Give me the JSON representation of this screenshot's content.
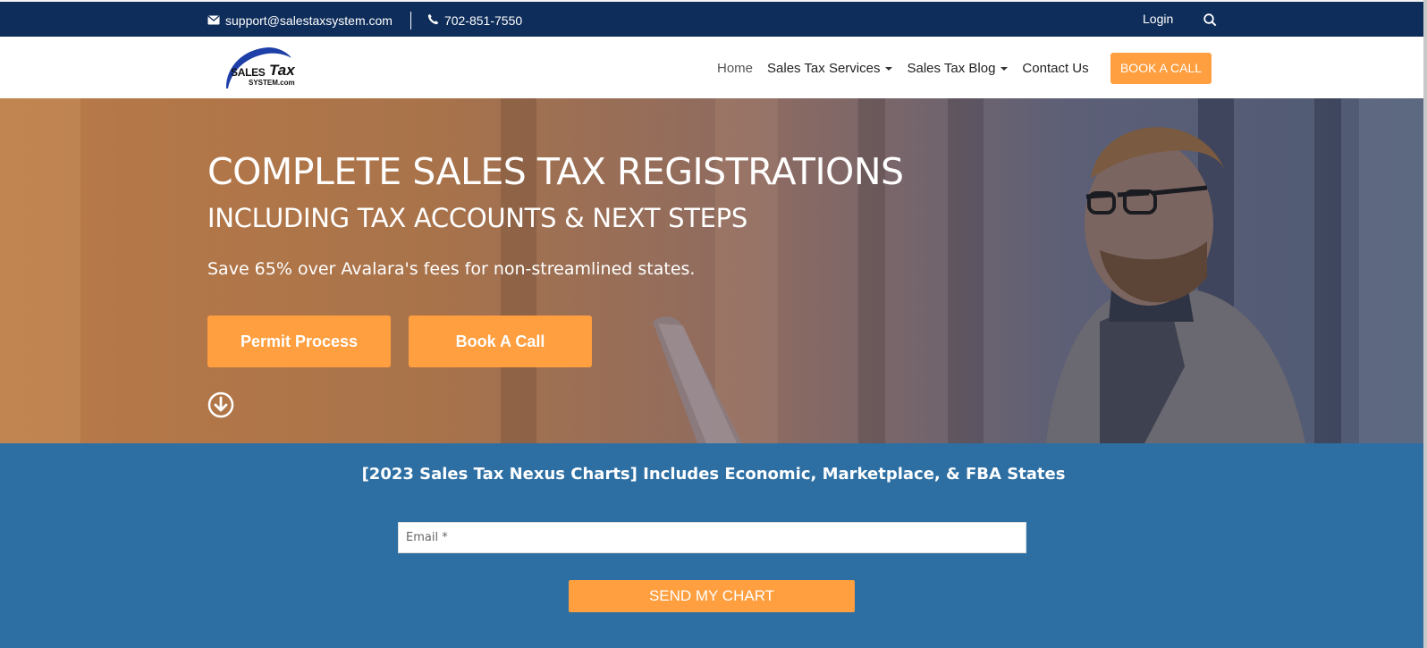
{
  "topbar": {
    "email": "support@salestaxsystem.com",
    "phone": "702-851-7550",
    "login": "Login"
  },
  "logo": {
    "word1": "SALES",
    "word2": "Tax",
    "word3": "SYSTEM.com"
  },
  "nav": {
    "items": [
      {
        "label": "Home"
      },
      {
        "label": "Sales Tax Services"
      },
      {
        "label": "Sales Tax Blog"
      },
      {
        "label": "Contact Us"
      }
    ],
    "cta": "BOOK A CALL"
  },
  "hero": {
    "title": "COMPLETE SALES TAX REGISTRATIONS",
    "subtitle": "INCLUDING TAX ACCOUNTS & NEXT STEPS",
    "tagline": "Save 65% over Avalara's fees for non-streamlined states.",
    "primary_button": "Permit Process",
    "secondary_button": "Book A Call"
  },
  "lead": {
    "heading": "[2023 Sales Tax Nexus Charts] Includes Economic, Marketplace, & FBA States",
    "email_placeholder": "Email *",
    "submit": "SEND MY CHART"
  },
  "colors": {
    "navy": "#0e2d5a",
    "accent": "#ff9f40",
    "blue": "#2d6fa3"
  },
  "icons": {
    "email": "envelope-icon",
    "phone": "phone-icon",
    "search": "search-icon",
    "scroll": "arrow-down-circle-icon"
  }
}
